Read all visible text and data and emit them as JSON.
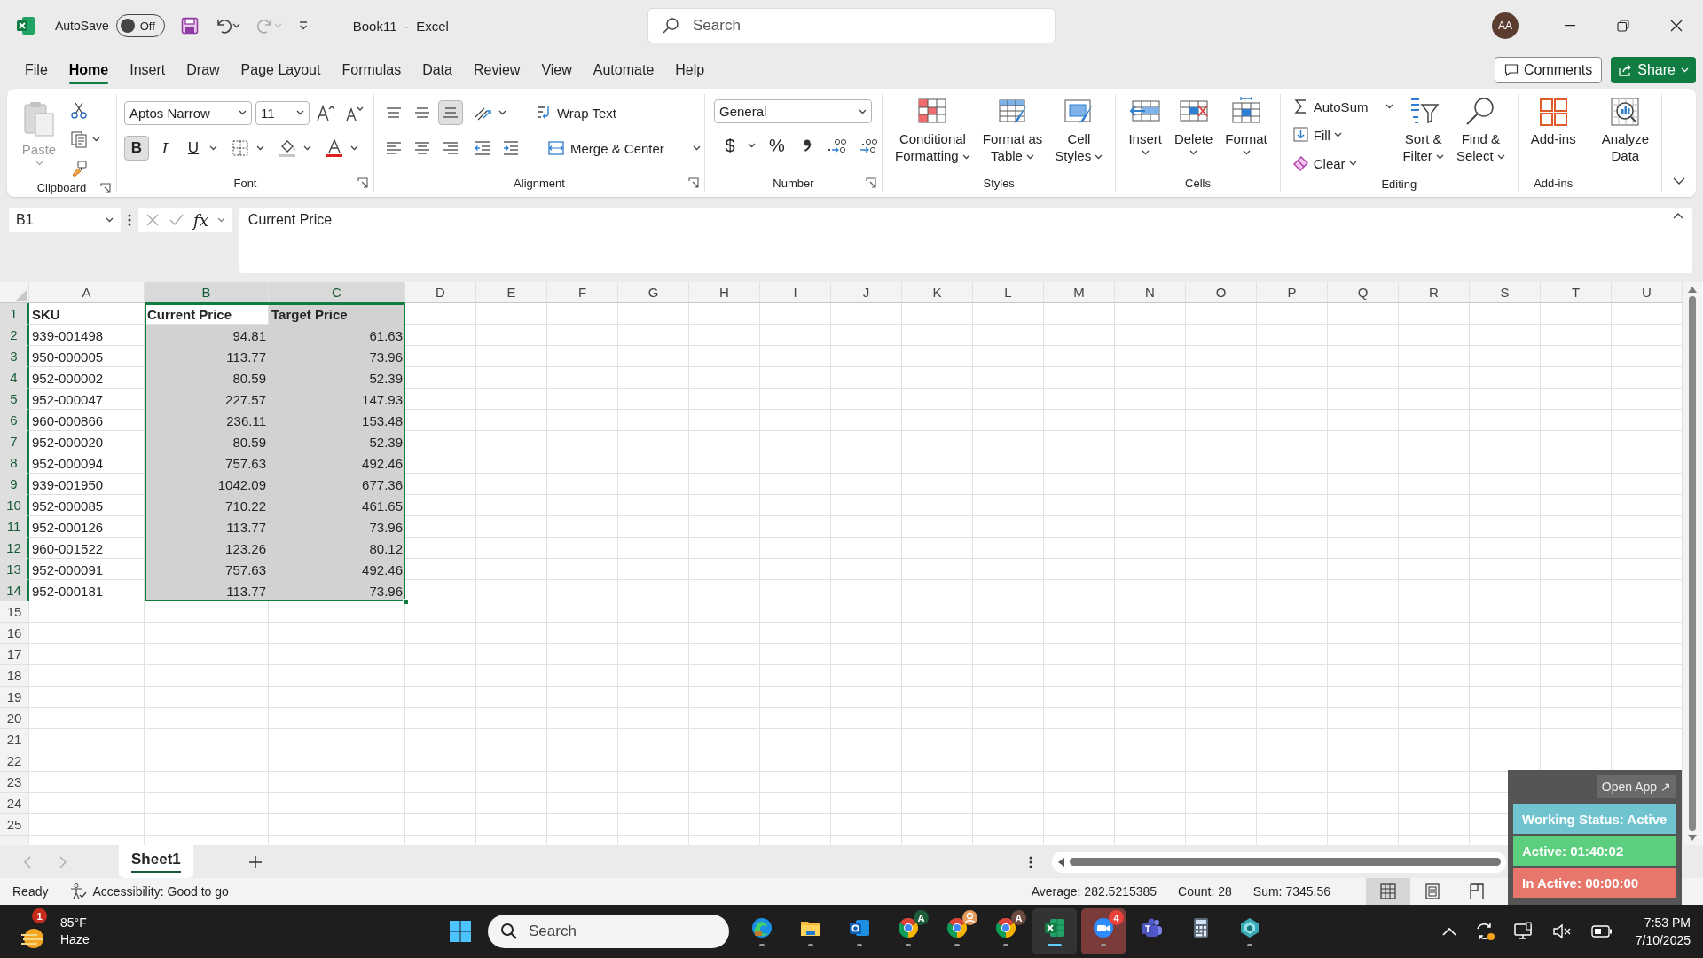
{
  "title_bar": {
    "autosave": {
      "label": "AutoSave",
      "on": false,
      "state_text": "Off"
    },
    "title": "Book11  -  Excel",
    "search": {
      "placeholder": "Search"
    },
    "avatar": "AA"
  },
  "menu": {
    "tabs": [
      {
        "label": "File",
        "selected": false
      },
      {
        "label": "Home",
        "selected": true
      },
      {
        "label": "Insert",
        "selected": false
      },
      {
        "label": "Draw",
        "selected": false
      },
      {
        "label": "Page Layout",
        "selected": false
      },
      {
        "label": "Formulas",
        "selected": false
      },
      {
        "label": "Data",
        "selected": false
      },
      {
        "label": "Review",
        "selected": false
      },
      {
        "label": "View",
        "selected": false
      },
      {
        "label": "Automate",
        "selected": false
      },
      {
        "label": "Help",
        "selected": false
      }
    ],
    "comments": "Comments",
    "share": "Share"
  },
  "ribbon": {
    "groups": [
      {
        "kind": "clipboard",
        "label": "Clipboard",
        "launcher": true,
        "paste": "Paste"
      },
      {
        "kind": "font",
        "label": "Font",
        "launcher": true,
        "font_name": "Aptos Narrow",
        "font_size": "11",
        "style_buttons": [
          {
            "kind": "bold",
            "label": "B",
            "selected": true
          },
          {
            "kind": "italic",
            "label": "I",
            "selected": false
          },
          {
            "kind": "underline",
            "label": "U",
            "selected": false
          }
        ]
      },
      {
        "kind": "alignment",
        "label": "Alignment",
        "launcher": true,
        "vertical_align": [
          {
            "selected": false
          },
          {
            "selected": false
          },
          {
            "selected": true
          }
        ],
        "wrap_text": "Wrap Text",
        "merge": "Merge & Center"
      },
      {
        "kind": "number",
        "label": "Number",
        "launcher": true,
        "format": "General",
        "currency": "$",
        "percent": "%"
      },
      {
        "kind": "buttons",
        "label": "Styles",
        "buttons": [
          {
            "kind": "conditional",
            "lines": [
              "Conditional",
              "Formatting"
            ],
            "menu": true
          },
          {
            "kind": "table",
            "lines": [
              "Format as",
              "Table"
            ],
            "menu": true
          },
          {
            "kind": "styles",
            "lines": [
              "Cell",
              "Styles"
            ],
            "menu": true
          }
        ]
      },
      {
        "kind": "buttons",
        "label": "Cells",
        "buttons": [
          {
            "kind": "insert",
            "lines": [
              "Insert"
            ],
            "menu": true
          },
          {
            "kind": "delete",
            "lines": [
              "Delete"
            ],
            "menu": true
          },
          {
            "kind": "format",
            "lines": [
              "Format"
            ],
            "menu": true
          }
        ]
      },
      {
        "kind": "editing",
        "label": "Editing",
        "small": [
          {
            "kind": "autosum",
            "label": "AutoSum"
          },
          {
            "kind": "fill",
            "label": "Fill"
          },
          {
            "kind": "clear",
            "label": "Clear"
          }
        ],
        "buttons": [
          {
            "kind": "sort",
            "lines": [
              "Sort &",
              "Filter"
            ],
            "menu": true
          },
          {
            "kind": "find",
            "lines": [
              "Find &",
              "Select"
            ],
            "menu": true
          }
        ]
      },
      {
        "kind": "buttons",
        "label": "Add-ins",
        "buttons": [
          {
            "kind": "addins",
            "lines": [
              "Add-ins"
            ]
          }
        ]
      },
      {
        "kind": "buttons",
        "buttons": [
          {
            "kind": "analyze",
            "lines": [
              "Analyze",
              "Data"
            ]
          }
        ]
      }
    ]
  },
  "formula_bar": {
    "name_box": "B1",
    "insert_function": "fx",
    "formula": "Current Price"
  },
  "sheet": {
    "columns": [
      {
        "label": "A",
        "selected": false
      },
      {
        "label": "B",
        "selected": true,
        "active": true
      },
      {
        "label": "C",
        "selected": true
      },
      {
        "label": "D",
        "selected": false
      },
      {
        "label": "E",
        "selected": false
      },
      {
        "label": "F",
        "selected": false
      },
      {
        "label": "G",
        "selected": false
      },
      {
        "label": "H",
        "selected": false
      },
      {
        "label": "I",
        "selected": false
      },
      {
        "label": "J",
        "selected": false
      },
      {
        "label": "K",
        "selected": false
      },
      {
        "label": "L",
        "selected": false
      },
      {
        "label": "M",
        "selected": false
      },
      {
        "label": "N",
        "selected": false
      },
      {
        "label": "O",
        "selected": false
      },
      {
        "label": "P",
        "selected": false
      },
      {
        "label": "Q",
        "selected": false
      },
      {
        "label": "R",
        "selected": false
      },
      {
        "label": "S",
        "selected": false
      },
      {
        "label": "T",
        "selected": false
      },
      {
        "label": "U",
        "selected": false
      }
    ],
    "rows": [
      {
        "header": "1",
        "kind": "header",
        "selected": true,
        "active": true,
        "cells": [
          "SKU",
          "Current Price",
          "Target Price"
        ]
      },
      {
        "header": "2",
        "kind": "data",
        "selected": true,
        "cells": [
          "939-001498",
          "94.81",
          "61.63"
        ]
      },
      {
        "header": "3",
        "kind": "data",
        "selected": true,
        "cells": [
          "950-000005",
          "113.77",
          "73.96"
        ]
      },
      {
        "header": "4",
        "kind": "data",
        "selected": true,
        "cells": [
          "952-000002",
          "80.59",
          "52.39"
        ]
      },
      {
        "header": "5",
        "kind": "data",
        "selected": true,
        "cells": [
          "952-000047",
          "227.57",
          "147.93"
        ]
      },
      {
        "header": "6",
        "kind": "data",
        "selected": true,
        "cells": [
          "960-000866",
          "236.11",
          "153.48"
        ]
      },
      {
        "header": "7",
        "kind": "data",
        "selected": true,
        "cells": [
          "952-000020",
          "80.59",
          "52.39"
        ]
      },
      {
        "header": "8",
        "kind": "data",
        "selected": true,
        "cells": [
          "952-000094",
          "757.63",
          "492.46"
        ]
      },
      {
        "header": "9",
        "kind": "data",
        "selected": true,
        "cells": [
          "939-001950",
          "1042.09",
          "677.36"
        ]
      },
      {
        "header": "10",
        "kind": "data",
        "selected": true,
        "cells": [
          "952-000085",
          "710.22",
          "461.65"
        ]
      },
      {
        "header": "11",
        "kind": "data",
        "selected": true,
        "cells": [
          "952-000126",
          "113.77",
          "73.96"
        ]
      },
      {
        "header": "12",
        "kind": "data",
        "selected": true,
        "cells": [
          "960-001522",
          "123.26",
          "80.12"
        ]
      },
      {
        "header": "13",
        "kind": "data",
        "selected": true,
        "cells": [
          "952-000091",
          "757.63",
          "492.46"
        ]
      },
      {
        "header": "14",
        "kind": "data",
        "selected": true,
        "cells": [
          "952-000181",
          "113.77",
          "73.96"
        ]
      },
      {
        "header": "15",
        "kind": "data",
        "selected": false,
        "cells": []
      },
      {
        "header": "16",
        "kind": "data",
        "selected": false,
        "cells": []
      },
      {
        "header": "17",
        "kind": "data",
        "selected": false,
        "cells": []
      },
      {
        "header": "18",
        "kind": "data",
        "selected": false,
        "cells": []
      },
      {
        "header": "19",
        "kind": "data",
        "selected": false,
        "cells": []
      },
      {
        "header": "20",
        "kind": "data",
        "selected": false,
        "cells": []
      },
      {
        "header": "21",
        "kind": "data",
        "selected": false,
        "cells": []
      },
      {
        "header": "22",
        "kind": "data",
        "selected": false,
        "cells": []
      },
      {
        "header": "23",
        "kind": "data",
        "selected": false,
        "cells": []
      },
      {
        "header": "24",
        "kind": "data",
        "selected": false,
        "cells": []
      },
      {
        "header": "25",
        "kind": "data",
        "selected": false,
        "cells": []
      }
    ]
  },
  "sheet_tabs": [
    {
      "label": "Sheet1",
      "selected": true
    }
  ],
  "status_bar": {
    "mode": "Ready",
    "accessibility": "Accessibility: Good to go",
    "stats": [
      "Average: 282.5215385",
      "Count: 28",
      "Sum: 7345.56"
    ],
    "views": [
      {
        "kind": "normal",
        "selected": true
      },
      {
        "kind": "page_layout",
        "selected": false
      },
      {
        "kind": "page_break",
        "selected": false
      }
    ]
  },
  "tracker_widget": {
    "open_app": "Open App ↗",
    "statuses": [
      {
        "text": "Working Status: Active",
        "color": "#6fc4cf"
      },
      {
        "text": "Active: 01:40:02",
        "color": "#5bcf7e"
      },
      {
        "text": "In Active: 00:00:00",
        "color": "#e8766b"
      }
    ]
  },
  "taskbar": {
    "weather": {
      "temperature": "85°F",
      "condition": "Haze",
      "badge": "1"
    },
    "search": {
      "placeholder": "Search"
    },
    "apps": [
      {
        "kind": "edge",
        "running": true,
        "selected": false,
        "flashing": false
      },
      {
        "kind": "explorer",
        "running": true,
        "selected": false,
        "flashing": false
      },
      {
        "kind": "outlook",
        "running": true,
        "selected": false,
        "flashing": false
      },
      {
        "kind": "chrome",
        "running": true,
        "selected": false,
        "flashing": false,
        "badge": {
          "kind": "letter",
          "text": "A",
          "color": "#1e5c3a"
        }
      },
      {
        "kind": "chrome",
        "running": true,
        "selected": false,
        "flashing": false,
        "badge": {
          "kind": "profile",
          "color": "#e59a5c"
        }
      },
      {
        "kind": "chrome",
        "running": true,
        "selected": false,
        "flashing": false,
        "badge": {
          "kind": "letter",
          "text": "A",
          "color": "#6b4a40"
        }
      },
      {
        "kind": "excel",
        "running": true,
        "selected": true,
        "flashing": false
      },
      {
        "kind": "zoom",
        "running": true,
        "selected": false,
        "flashing": true,
        "badge": {
          "kind": "count",
          "text": "4",
          "color": "#e8423a"
        }
      },
      {
        "kind": "teams",
        "running": false,
        "selected": false,
        "flashing": false
      },
      {
        "kind": "calculator",
        "running": false,
        "selected": false,
        "flashing": false
      },
      {
        "kind": "app",
        "running": true,
        "selected": false,
        "flashing": false
      }
    ],
    "time": "7:53 PM",
    "date": "7/10/2025"
  }
}
